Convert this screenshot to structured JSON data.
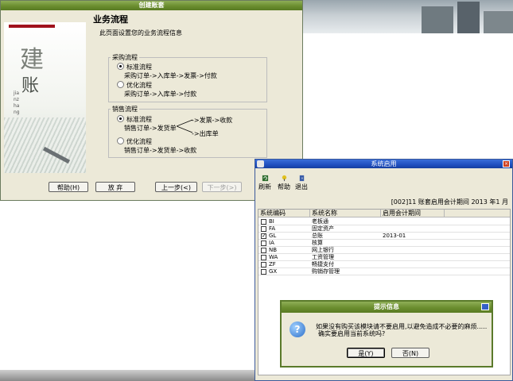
{
  "wizard": {
    "title": "创建账套",
    "side_big1": "建",
    "side_big2": "账",
    "side_vertical": "jianzhang",
    "page_title": "业务流程",
    "page_desc": "此页面设置您的业务流程信息",
    "purchase": {
      "legend": "采购流程",
      "standard_label": "标准流程",
      "standard_desc": "采购订单->入库单->发票->付款",
      "optimized_label": "优化流程",
      "optimized_desc": "采购订单->入库单->付款"
    },
    "sales": {
      "legend": "销售流程",
      "standard_label": "标准流程",
      "standard_desc": "销售订单->发货单",
      "branch_top": "->发票->收款",
      "branch_bottom": "->出库单",
      "optimized_label": "优化流程",
      "optimized_desc": "销售订单->发货单->收款"
    },
    "buttons": {
      "help": "帮助(H)",
      "abandon": "放 弃",
      "prev": "上一步(<)",
      "next": "下一步(>)"
    }
  },
  "system_window": {
    "title": "系统启用",
    "toolbar": {
      "refresh": "刷新",
      "help": "帮助",
      "exit": "退出"
    },
    "period_info": "[002]11 账套启用会计期间 2013 年1 月",
    "columns": [
      "系统编码",
      "系统名称",
      "启用会计期间"
    ],
    "rows": [
      {
        "code": "BI",
        "name": "老板通",
        "period": "",
        "checked": false
      },
      {
        "code": "FA",
        "name": "固定资产",
        "period": "",
        "checked": false
      },
      {
        "code": "GL",
        "name": "总账",
        "period": "2013-01",
        "checked": true
      },
      {
        "code": "IA",
        "name": "核算",
        "period": "",
        "checked": false
      },
      {
        "code": "NB",
        "name": "网上银行",
        "period": "",
        "checked": false
      },
      {
        "code": "WA",
        "name": "工资管理",
        "period": "",
        "checked": false
      },
      {
        "code": "ZF",
        "name": "畅捷支付",
        "period": "",
        "checked": false
      },
      {
        "code": "GX",
        "name": "购销存管理",
        "period": "",
        "checked": false
      }
    ]
  },
  "dialog": {
    "title": "提示信息",
    "message_line1": "如果没有购买该模块请不要启用,以避免造成不必要的麻烦.....",
    "message_line2": "确实要启用当前系统吗?",
    "yes": "是(Y)",
    "no": "否(N)"
  },
  "colors": {
    "wizard_titlebar": "#6b8e2f",
    "system_titlebar": "#1f4fc0",
    "dialog_titlebar": "#6b8e2f"
  }
}
